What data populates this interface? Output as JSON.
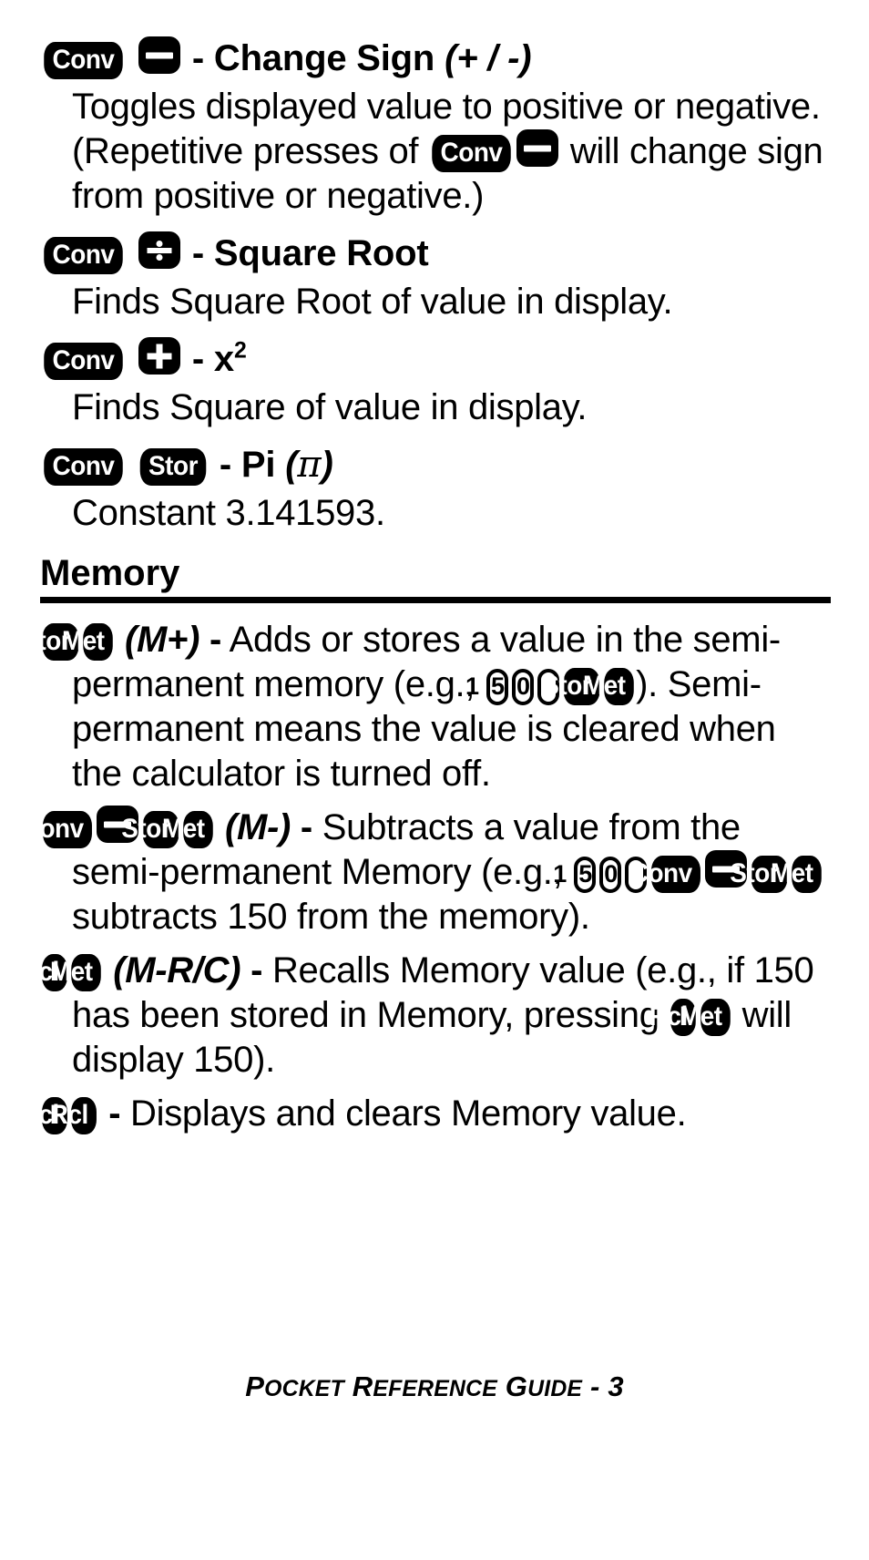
{
  "page": {
    "footer_prefix": "P",
    "footer": "POCKET REFERENCE GUIDE - 3",
    "footer_parts": {
      "p1_cap": "P",
      "p1_rest": "OCKET",
      "p2_cap": "R",
      "p2_rest": "EFERENCE",
      "p3_cap": "G",
      "p3_rest": "UIDE",
      "tail": " - 3"
    }
  },
  "entries": [
    {
      "id": "change-sign",
      "keys": [
        {
          "type": "label",
          "text": "Conv"
        },
        {
          "type": "op",
          "glyph": "minus"
        }
      ],
      "dash": "-",
      "title": "Change Sign",
      "alt": "(+ / -)",
      "body_pre": "Toggles displayed value to positive or negative. (Repetitive presses of ",
      "inline_keys": [
        {
          "type": "label",
          "text": "Conv"
        },
        {
          "type": "op",
          "glyph": "minus"
        }
      ],
      "body_post": " will change sign from positive or negative.)"
    },
    {
      "id": "square-root",
      "keys": [
        {
          "type": "label",
          "text": "Conv"
        },
        {
          "type": "op",
          "glyph": "divide"
        }
      ],
      "dash": "-",
      "title": "Square Root",
      "alt": "",
      "body": "Finds Square Root of value in display."
    },
    {
      "id": "x-squared",
      "keys": [
        {
          "type": "label",
          "text": "Conv"
        },
        {
          "type": "op",
          "glyph": "plus"
        }
      ],
      "dash": "-",
      "title": "x",
      "title_sup": "2",
      "alt": "",
      "body": "Finds Square of value in display."
    },
    {
      "id": "pi",
      "keys": [
        {
          "type": "label",
          "text": "Conv"
        },
        {
          "type": "label",
          "text": "Stor"
        }
      ],
      "dash": "-",
      "title": "Pi",
      "alt_open": "(",
      "alt_pi": "π",
      "alt_close": ")",
      "body": "Constant 3.141593."
    }
  ],
  "memory": {
    "heading": "Memory",
    "items": [
      {
        "id": "m-plus",
        "lead_keys": [
          {
            "type": "label",
            "text": "Stor"
          },
          {
            "type": "label",
            "text": "Met"
          }
        ],
        "code": "(M+)",
        "dash": "-",
        "text_a": " Adds or stores a value in the semi-permanent memory (e.g., ",
        "example_keys": [
          {
            "type": "digit",
            "text": "1"
          },
          {
            "type": "digit",
            "text": "5"
          },
          {
            "type": "digit",
            "text": "0"
          },
          {
            "type": "label",
            "text": "Stor"
          },
          {
            "type": "label",
            "text": "Met"
          }
        ],
        "text_b": "). Semi-permanent means the value is cleared when the calculator is turned off."
      },
      {
        "id": "m-minus",
        "lead_keys": [
          {
            "type": "label",
            "text": "Conv"
          },
          {
            "type": "op",
            "glyph": "minus"
          },
          {
            "type": "label",
            "text": "Stor"
          },
          {
            "type": "label",
            "text": "Met"
          }
        ],
        "code": "(M-)",
        "dash": "-",
        "text_a": " Subtracts a value from the semi-permanent Memory (e.g., ",
        "example_keys": [
          {
            "type": "digit",
            "text": "1"
          },
          {
            "type": "digit",
            "text": "5"
          },
          {
            "type": "digit",
            "text": "0"
          },
          {
            "type": "label",
            "text": "Conv"
          },
          {
            "type": "op",
            "glyph": "minus"
          },
          {
            "type": "label",
            "text": "Stor"
          },
          {
            "type": "label",
            "text": "Met"
          }
        ],
        "text_b": " subtracts 150 from the memory)."
      },
      {
        "id": "m-rc",
        "lead_keys": [
          {
            "type": "label",
            "text": "Rcl"
          },
          {
            "type": "label",
            "text": "Met"
          }
        ],
        "code": "(M-R/C)",
        "dash": "-",
        "text_a": " Recalls Memory value (e.g., if 150 has been stored in Memory, pressing ",
        "example_keys": [
          {
            "type": "label",
            "text": "Rcl"
          },
          {
            "type": "label",
            "text": "Met"
          }
        ],
        "text_b": " will display 150)."
      },
      {
        "id": "rcl-rcl",
        "lead_keys": [
          {
            "type": "label",
            "text": "Rcl"
          },
          {
            "type": "label",
            "text": "Rcl"
          }
        ],
        "code": "",
        "dash": "-",
        "text_a": " Displays and clears Memory value.",
        "example_keys": [],
        "text_b": ""
      }
    ]
  }
}
